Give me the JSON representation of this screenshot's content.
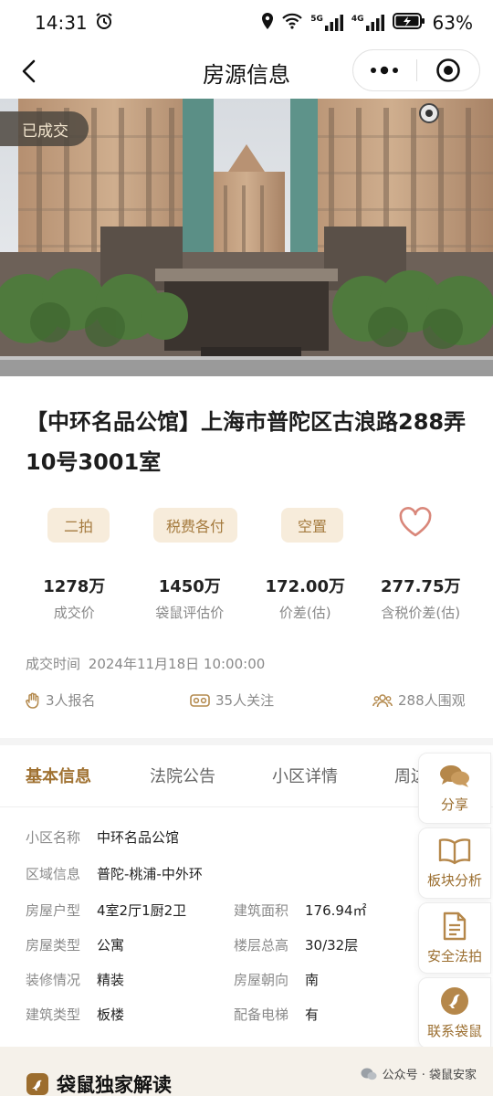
{
  "status_bar": {
    "time": "14:31",
    "battery": "63%",
    "net5g": "5G",
    "net4g": "4G"
  },
  "nav": {
    "title": "房源信息"
  },
  "hero": {
    "badge": "已成交"
  },
  "listing": {
    "title": "【中环名品公馆】上海市普陀区古浪路288弄10号3001室"
  },
  "tags": [
    "二拍",
    "税费各付",
    "空置"
  ],
  "stats": [
    {
      "value": "1278万",
      "label": "成交价"
    },
    {
      "value": "1450万",
      "label": "袋鼠评估价"
    },
    {
      "value": "172.00万",
      "label": "价差(估)"
    },
    {
      "value": "277.75万",
      "label": "含税价差(估)"
    }
  ],
  "deal_time": {
    "label": "成交时间",
    "value": "2024年11月18日 10:00:00"
  },
  "metrics": {
    "signups": "3人报名",
    "follows": "35人关注",
    "watchers": "288人围观"
  },
  "tabs": [
    "基本信息",
    "法院公告",
    "小区详情",
    "周边"
  ],
  "info": {
    "community": {
      "k": "小区名称",
      "v": "中环名品公馆"
    },
    "region": {
      "k": "区域信息",
      "v": "普陀-桃浦-中外环"
    },
    "layout": {
      "k": "房屋户型",
      "v": "4室2厅1厨2卫"
    },
    "area": {
      "k": "建筑面积",
      "v": "176.94㎡"
    },
    "type": {
      "k": "房屋类型",
      "v": "公寓"
    },
    "floor": {
      "k": "楼层总高",
      "v": "30/32层"
    },
    "decor": {
      "k": "装修情况",
      "v": "精装"
    },
    "facing": {
      "k": "房屋朝向",
      "v": "南"
    },
    "building": {
      "k": "建筑类型",
      "v": "板楼"
    },
    "elevator": {
      "k": "配备电梯",
      "v": "有"
    }
  },
  "side_actions": [
    "分享",
    "板块分析",
    "安全法拍",
    "联系袋鼠"
  ],
  "bottom": {
    "section_title": "袋鼠独家解读",
    "watermark": "公众号 · 袋鼠安家"
  },
  "colors": {
    "accent": "#a07232",
    "tag_bg": "#f7ecdb",
    "heart": "#d9877a"
  }
}
